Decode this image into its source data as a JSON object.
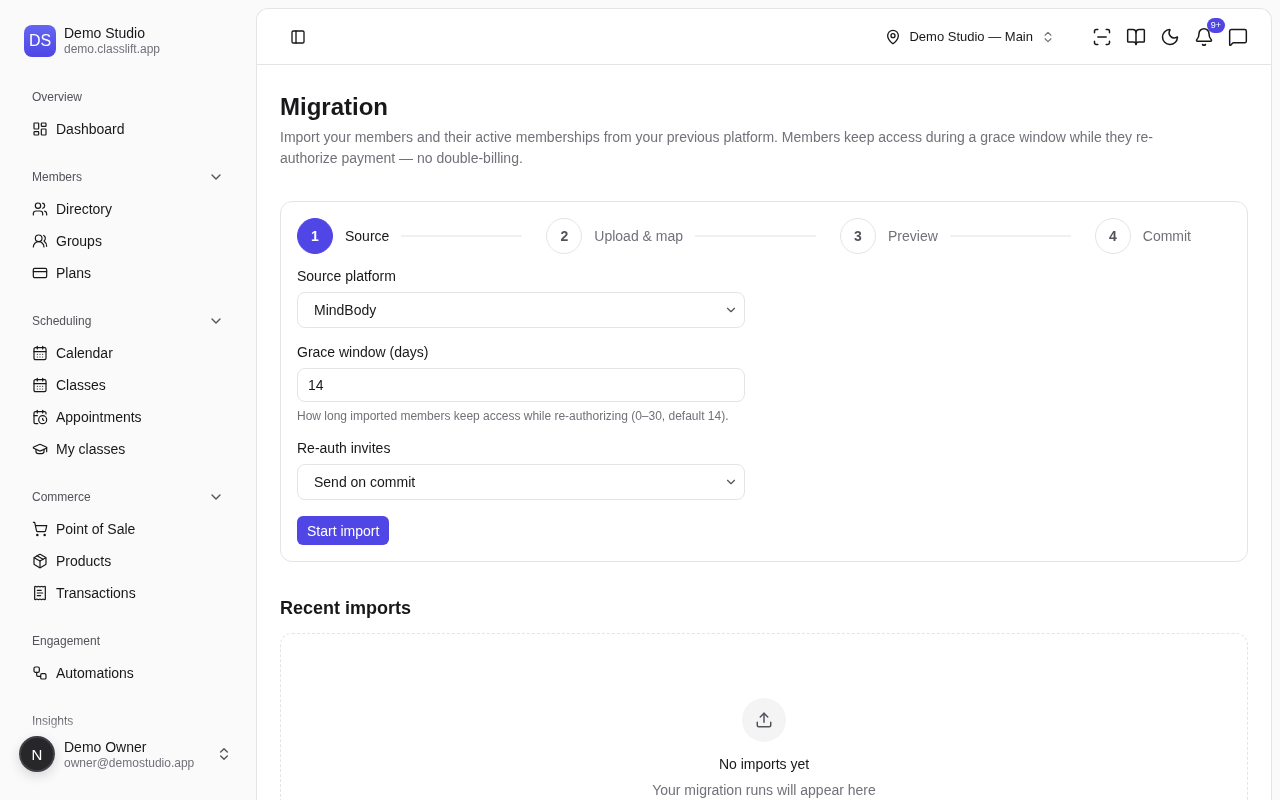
{
  "brand": {
    "initials": "DS",
    "name": "Demo Studio",
    "domain": "demo.classlift.app"
  },
  "sidebar": {
    "sections": [
      {
        "title": "Overview",
        "kind": "static",
        "items": [
          "Dashboard"
        ]
      },
      {
        "title": "Members",
        "kind": "collapsible",
        "items": [
          "Directory",
          "Groups",
          "Plans"
        ]
      },
      {
        "title": "Scheduling",
        "kind": "collapsible",
        "items": [
          "Calendar",
          "Classes",
          "Appointments",
          "My classes"
        ]
      },
      {
        "title": "Commerce",
        "kind": "collapsible",
        "items": [
          "Point of Sale",
          "Products",
          "Transactions"
        ]
      },
      {
        "title": "Engagement",
        "kind": "static",
        "items": [
          "Automations"
        ]
      },
      {
        "title": "Insights",
        "kind": "static"
      }
    ]
  },
  "user": {
    "initial": "N",
    "name": "Demo Owner",
    "email": "owner@demostudio.app"
  },
  "topbar": {
    "location": "Demo Studio — Main",
    "notification_badge": "9+"
  },
  "page": {
    "title": "Migration",
    "description": "Import your members and their active memberships from your previous platform. Members keep access during a grace window while they re-authorize payment — no double-billing."
  },
  "steps": [
    {
      "number": "1",
      "label": "Source",
      "selected": true
    },
    {
      "number": "2",
      "label": "Upload & map",
      "selected": false
    },
    {
      "number": "3",
      "label": "Preview",
      "selected": false
    },
    {
      "number": "4",
      "label": "Commit",
      "selected": false
    }
  ],
  "form": {
    "fields": [
      {
        "kind": "select",
        "label": "Source platform",
        "value": "MindBody"
      },
      {
        "kind": "input",
        "label": "Grace window (days)",
        "value": "14",
        "help": "How long imported members keep access while re-authorizing (0–30, default 14)."
      },
      {
        "kind": "select",
        "label": "Re-auth invites",
        "value": "Send on commit"
      }
    ],
    "submit": "Start import"
  },
  "recent": {
    "title": "Recent imports",
    "empty_title": "No imports yet",
    "empty_text": "Your migration runs will appear here"
  }
}
